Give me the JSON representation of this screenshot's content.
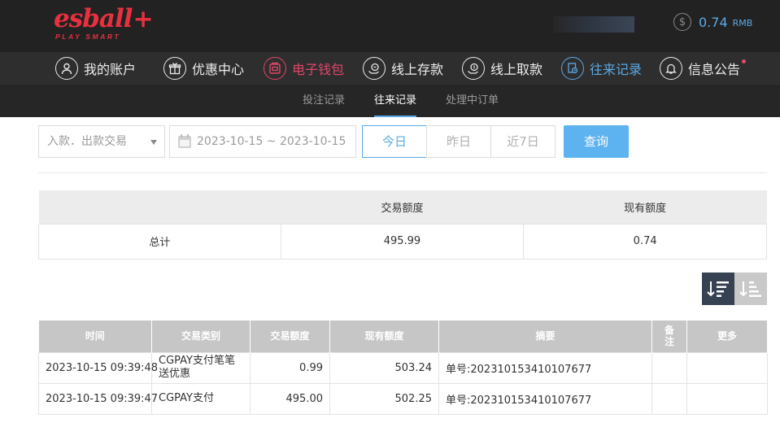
{
  "header": {
    "logo_text": "esball",
    "logo_plus": "+",
    "logo_tagline": "PLAY SMART",
    "balance_icon": "$",
    "balance_amount": "0.74",
    "balance_currency": "RMB"
  },
  "nav": {
    "items": [
      {
        "label": "我的账户",
        "icon": "user-icon"
      },
      {
        "label": "优惠中心",
        "icon": "gift-icon"
      },
      {
        "label": "电子钱包",
        "icon": "wallet-icon"
      },
      {
        "label": "线上存款",
        "icon": "deposit-icon"
      },
      {
        "label": "线上取款",
        "icon": "withdraw-icon"
      },
      {
        "label": "往来记录",
        "icon": "records-icon"
      },
      {
        "label": "信息公告",
        "icon": "bell-icon"
      }
    ]
  },
  "subnav": {
    "items": [
      {
        "label": "投注记录"
      },
      {
        "label": "往来记录"
      },
      {
        "label": "处理中订单"
      }
    ]
  },
  "filters": {
    "type_select": "入款．出款交易",
    "date_range": "2023-10-15 ~ 2023-10-15",
    "today": "今日",
    "yesterday": "昨日",
    "last7": "近7日",
    "query": "查询"
  },
  "summary": {
    "headers": [
      "",
      "交易额度",
      "现有额度"
    ],
    "row": [
      "总计",
      "495.99",
      "0.74"
    ]
  },
  "records": {
    "headers": [
      "时间",
      "交易类别",
      "交易额度",
      "现有额度",
      "摘要",
      "备注",
      "更多"
    ],
    "rows": [
      [
        "2023-10-15 09:39:48",
        "CGPAY支付笔笔送优惠",
        "0.99",
        "503.24",
        "单号:202310153410107677",
        "",
        ""
      ],
      [
        "2023-10-15 09:39:47",
        "CGPAY支付",
        "495.00",
        "502.25",
        "单号:202310153410107677",
        "",
        ""
      ]
    ]
  },
  "colors": {
    "accent": "#5aa9e6",
    "brand": "#e8303f",
    "wallet": "#e0466a"
  }
}
